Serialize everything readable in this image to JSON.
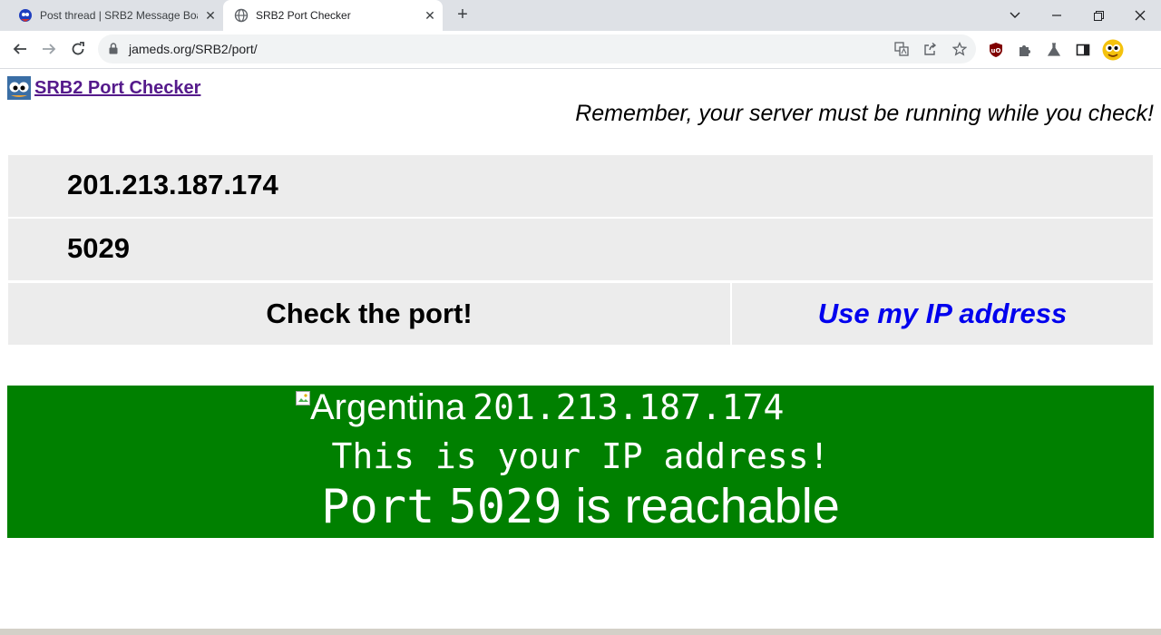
{
  "browser": {
    "tabs": [
      {
        "title": "Post thread | SRB2 Message Boa",
        "icon": "srb2-favicon",
        "active": false
      },
      {
        "title": "SRB2 Port Checker",
        "icon": "globe-icon",
        "active": true
      }
    ],
    "url": "jameds.org/SRB2/port/",
    "close_glyph": "✕",
    "new_tab_glyph": "+"
  },
  "page": {
    "logo_link_label": "SRB2 Port Checker",
    "reminder": "Remember, your server must be running while you check!",
    "ip_value": "201.213.187.174",
    "port_value": "5029",
    "check_button": "Check the port!",
    "my_ip_link": "Use my IP address"
  },
  "result": {
    "flag_alt": "Argentina",
    "ip": "201.213.187.174",
    "your_ip_note": "This is your IP address!",
    "port_word": "Port",
    "port_number": "5029",
    "status": "is reachable",
    "background_color": "#008000"
  },
  "colors": {
    "link_visited": "#551a8b",
    "link_blue": "#0000ee",
    "field_bg": "#ececec"
  }
}
